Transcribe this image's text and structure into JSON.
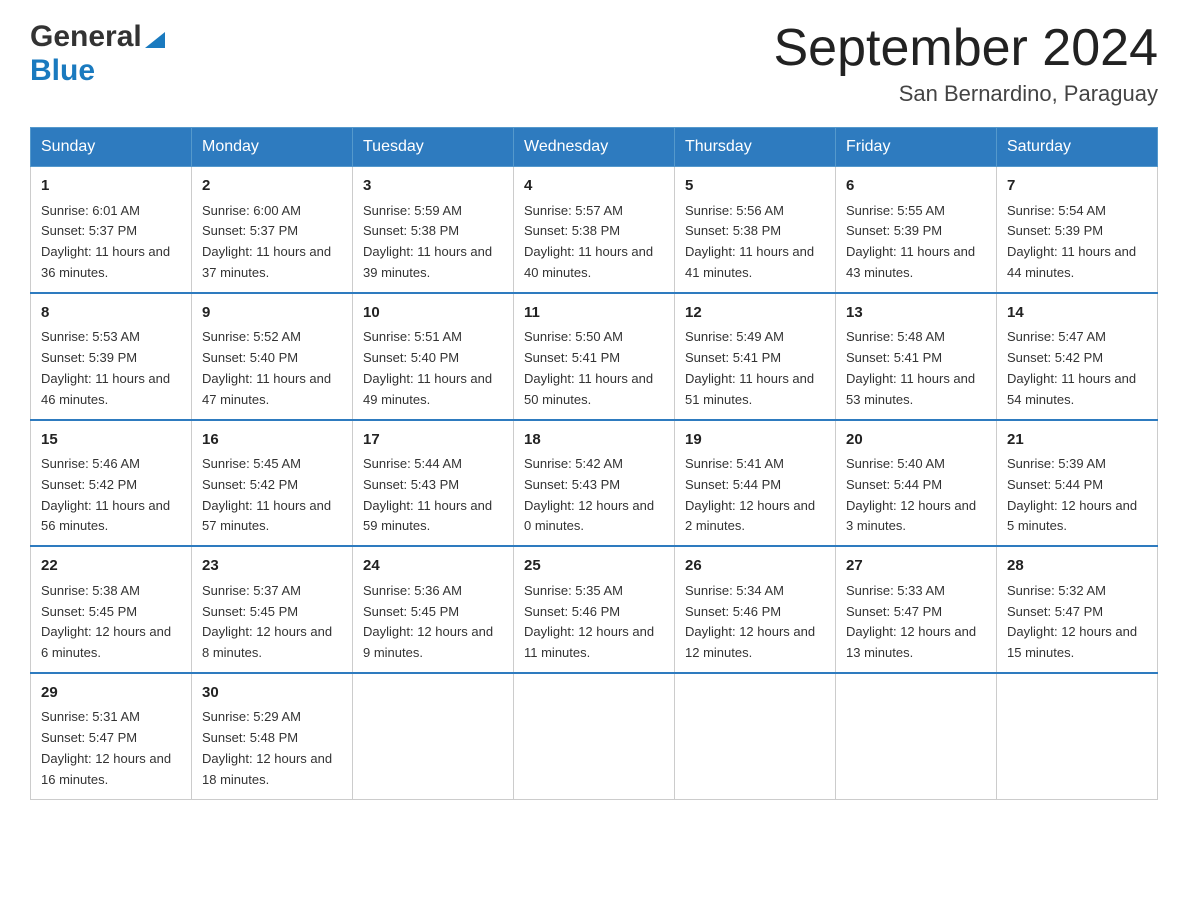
{
  "header": {
    "logo_general": "General",
    "logo_blue": "Blue",
    "month_year": "September 2024",
    "location": "San Bernardino, Paraguay"
  },
  "weekdays": [
    "Sunday",
    "Monday",
    "Tuesday",
    "Wednesday",
    "Thursday",
    "Friday",
    "Saturday"
  ],
  "weeks": [
    [
      {
        "day": "1",
        "sunrise": "6:01 AM",
        "sunset": "5:37 PM",
        "daylight": "11 hours and 36 minutes."
      },
      {
        "day": "2",
        "sunrise": "6:00 AM",
        "sunset": "5:37 PM",
        "daylight": "11 hours and 37 minutes."
      },
      {
        "day": "3",
        "sunrise": "5:59 AM",
        "sunset": "5:38 PM",
        "daylight": "11 hours and 39 minutes."
      },
      {
        "day": "4",
        "sunrise": "5:57 AM",
        "sunset": "5:38 PM",
        "daylight": "11 hours and 40 minutes."
      },
      {
        "day": "5",
        "sunrise": "5:56 AM",
        "sunset": "5:38 PM",
        "daylight": "11 hours and 41 minutes."
      },
      {
        "day": "6",
        "sunrise": "5:55 AM",
        "sunset": "5:39 PM",
        "daylight": "11 hours and 43 minutes."
      },
      {
        "day": "7",
        "sunrise": "5:54 AM",
        "sunset": "5:39 PM",
        "daylight": "11 hours and 44 minutes."
      }
    ],
    [
      {
        "day": "8",
        "sunrise": "5:53 AM",
        "sunset": "5:39 PM",
        "daylight": "11 hours and 46 minutes."
      },
      {
        "day": "9",
        "sunrise": "5:52 AM",
        "sunset": "5:40 PM",
        "daylight": "11 hours and 47 minutes."
      },
      {
        "day": "10",
        "sunrise": "5:51 AM",
        "sunset": "5:40 PM",
        "daylight": "11 hours and 49 minutes."
      },
      {
        "day": "11",
        "sunrise": "5:50 AM",
        "sunset": "5:41 PM",
        "daylight": "11 hours and 50 minutes."
      },
      {
        "day": "12",
        "sunrise": "5:49 AM",
        "sunset": "5:41 PM",
        "daylight": "11 hours and 51 minutes."
      },
      {
        "day": "13",
        "sunrise": "5:48 AM",
        "sunset": "5:41 PM",
        "daylight": "11 hours and 53 minutes."
      },
      {
        "day": "14",
        "sunrise": "5:47 AM",
        "sunset": "5:42 PM",
        "daylight": "11 hours and 54 minutes."
      }
    ],
    [
      {
        "day": "15",
        "sunrise": "5:46 AM",
        "sunset": "5:42 PM",
        "daylight": "11 hours and 56 minutes."
      },
      {
        "day": "16",
        "sunrise": "5:45 AM",
        "sunset": "5:42 PM",
        "daylight": "11 hours and 57 minutes."
      },
      {
        "day": "17",
        "sunrise": "5:44 AM",
        "sunset": "5:43 PM",
        "daylight": "11 hours and 59 minutes."
      },
      {
        "day": "18",
        "sunrise": "5:42 AM",
        "sunset": "5:43 PM",
        "daylight": "12 hours and 0 minutes."
      },
      {
        "day": "19",
        "sunrise": "5:41 AM",
        "sunset": "5:44 PM",
        "daylight": "12 hours and 2 minutes."
      },
      {
        "day": "20",
        "sunrise": "5:40 AM",
        "sunset": "5:44 PM",
        "daylight": "12 hours and 3 minutes."
      },
      {
        "day": "21",
        "sunrise": "5:39 AM",
        "sunset": "5:44 PM",
        "daylight": "12 hours and 5 minutes."
      }
    ],
    [
      {
        "day": "22",
        "sunrise": "5:38 AM",
        "sunset": "5:45 PM",
        "daylight": "12 hours and 6 minutes."
      },
      {
        "day": "23",
        "sunrise": "5:37 AM",
        "sunset": "5:45 PM",
        "daylight": "12 hours and 8 minutes."
      },
      {
        "day": "24",
        "sunrise": "5:36 AM",
        "sunset": "5:45 PM",
        "daylight": "12 hours and 9 minutes."
      },
      {
        "day": "25",
        "sunrise": "5:35 AM",
        "sunset": "5:46 PM",
        "daylight": "12 hours and 11 minutes."
      },
      {
        "day": "26",
        "sunrise": "5:34 AM",
        "sunset": "5:46 PM",
        "daylight": "12 hours and 12 minutes."
      },
      {
        "day": "27",
        "sunrise": "5:33 AM",
        "sunset": "5:47 PM",
        "daylight": "12 hours and 13 minutes."
      },
      {
        "day": "28",
        "sunrise": "5:32 AM",
        "sunset": "5:47 PM",
        "daylight": "12 hours and 15 minutes."
      }
    ],
    [
      {
        "day": "29",
        "sunrise": "5:31 AM",
        "sunset": "5:47 PM",
        "daylight": "12 hours and 16 minutes."
      },
      {
        "day": "30",
        "sunrise": "5:29 AM",
        "sunset": "5:48 PM",
        "daylight": "12 hours and 18 minutes."
      },
      null,
      null,
      null,
      null,
      null
    ]
  ],
  "labels": {
    "sunrise": "Sunrise:",
    "sunset": "Sunset:",
    "daylight": "Daylight:"
  }
}
